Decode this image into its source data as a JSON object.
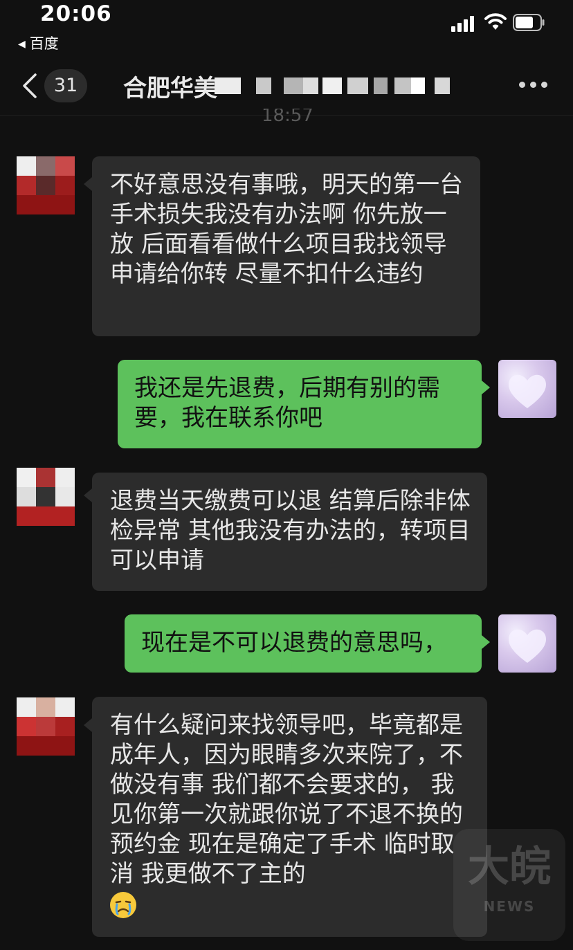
{
  "status_bar": {
    "time": "20:06",
    "back_app": "百度"
  },
  "nav": {
    "unread_count": "31",
    "title": "合肥华美"
  },
  "timestamp": "18:57",
  "messages": [
    {
      "side": "in",
      "text": "不好意思没有事哦，明天的第一台手术损失我没有办法啊  你先放一放   后面看看做什么项目我找领导申请给你转  尽量不扣什么违约"
    },
    {
      "side": "out",
      "text": "我还是先退费，后期有别的需要，我在联系你吧"
    },
    {
      "side": "in",
      "text": "退费当天缴费可以退  结算后除非体检异常  其他我没有办法的，转项目可以申请"
    },
    {
      "side": "out",
      "text": "现在是不可以退费的意思吗，"
    },
    {
      "side": "in",
      "text": "有什么疑问来找领导吧，毕竟都是成年人，因为眼睛多次来院了，不做没有事 我们都不会要求的， 我见你第一次就跟你说了不退不换的  预约金  现在是确定了手术  临时取消  我更做不了主的",
      "emoji": "sad-face-emoji"
    }
  ],
  "watermark": {
    "logo": "大皖",
    "sub": "NEWS"
  },
  "colors": {
    "background": "#111111",
    "incoming_bubble": "#2c2c2c",
    "outgoing_bubble": "#5dc15c"
  }
}
